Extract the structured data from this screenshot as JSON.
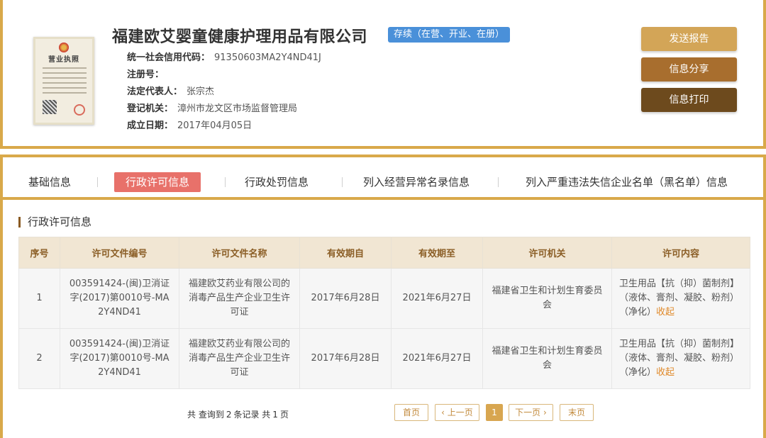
{
  "company": {
    "name": "福建欧艾婴童健康护理用品有限公司",
    "status": "存续（在营、开业、在册）",
    "license_title": "营业执照",
    "fields": [
      {
        "label": "统一社会信用代码：",
        "value": "91350603MA2Y4ND41J"
      },
      {
        "label": "注册号：",
        "value": ""
      },
      {
        "label": "法定代表人：",
        "value": "张宗杰"
      },
      {
        "label": "登记机关：",
        "value": "漳州市龙文区市场监督管理局"
      },
      {
        "label": "成立日期：",
        "value": "2017年04月05日"
      }
    ]
  },
  "actions": {
    "report": "发送报告",
    "share": "信息分享",
    "print": "信息打印"
  },
  "tabs": [
    {
      "label": "基础信息"
    },
    {
      "label": "行政许可信息"
    },
    {
      "label": "行政处罚信息"
    },
    {
      "label": "列入经营异常名录信息"
    },
    {
      "label": "列入严重违法失信企业名单（黑名单）信息"
    }
  ],
  "section": {
    "title": "行政许可信息"
  },
  "table": {
    "headers": [
      "序号",
      "许可文件编号",
      "许可文件名称",
      "有效期自",
      "有效期至",
      "许可机关",
      "许可内容"
    ],
    "rows": [
      {
        "no": "1",
        "doc_no": "003591424-(闽)卫消证字(2017)第0010号-MA2Y4ND41",
        "doc_name": "福建欧艾药业有限公司的消毒产品生产企业卫生许可证",
        "from": "2017年6月28日",
        "to": "2021年6月27日",
        "authority": "福建省卫生和计划生育委员会",
        "content": "卫生用品【抗（抑）菌制剂】（液体、膏剂、凝胶、粉剂）（净化）",
        "collapse": "收起"
      },
      {
        "no": "2",
        "doc_no": "003591424-(闽)卫消证字(2017)第0010号-MA2Y4ND41",
        "doc_name": "福建欧艾药业有限公司的消毒产品生产企业卫生许可证",
        "from": "2017年6月28日",
        "to": "2021年6月27日",
        "authority": "福建省卫生和计划生育委员会",
        "content": "卫生用品【抗（抑）菌制剂】（液体、膏剂、凝胶、粉剂）（净化）",
        "collapse": "收起"
      }
    ]
  },
  "pagination": {
    "prefix": "共 查询到",
    "count": "2",
    "mid": "条记录 共",
    "pages": "1",
    "suffix": "页",
    "first": "首页",
    "prev": "上一页",
    "current": "1",
    "next": "下一页",
    "last": "末页"
  },
  "colors": {
    "border": "#d9a94a",
    "status_badge": "#4a90d9",
    "active_tab": "#e8716a",
    "btn_report": "#d3a557",
    "btn_share": "#a86e2e",
    "btn_print": "#6d4a1d"
  }
}
